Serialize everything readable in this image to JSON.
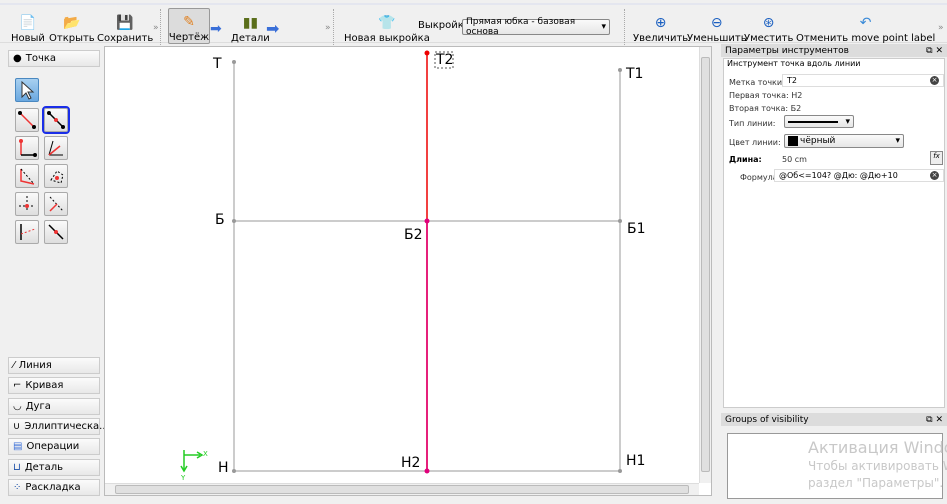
{
  "toolbar": {
    "new": "Новый",
    "open": "Открыть",
    "save": "Сохранить",
    "draw": "Чертёж",
    "details": "Детали",
    "new_pattern": "Новая выкройка",
    "pattern_label": "Выкройка:",
    "pattern_value": "Прямая юбка - базовая основа",
    "zoom_in": "Увеличить",
    "zoom_out": "Уменьшить",
    "fit": "Уместить",
    "undo": "Отменить move point label"
  },
  "left": {
    "group_point": "Точка",
    "groups": [
      "Линия",
      "Кривая",
      "Дуга",
      "Эллиптическа...",
      "Операции",
      "Деталь",
      "Раскладка"
    ]
  },
  "canvas": {
    "points": {
      "T": "Т",
      "T2": "Т2",
      "T1": "Т1",
      "B": "Б",
      "B2": "Б2",
      "B1": "Б1",
      "H": "Н",
      "H2": "Н2",
      "H1": "Н1"
    },
    "axis_x": "X",
    "axis_y": "Y",
    "accent_line_color": "#e0007a"
  },
  "tool_options": {
    "title": "Параметры инструментов",
    "subtitle": "Инструмент точка вдоль линии",
    "point_label_label": "Метка точки:",
    "point_label_value": "Т2",
    "first_point_label": "Первая точка:",
    "first_point_value": "Н2",
    "second_point_label": "Вторая точка:",
    "second_point_value": "Б2",
    "line_type_label": "Тип линии:",
    "line_color_label": "Цвет линии:",
    "line_color_value": "чёрный",
    "length_label": "Длина:",
    "length_value": "50 cm",
    "formula_label": "Формула",
    "formula_value": "@Об<=104? @Дю: @Дю+10"
  },
  "groups_panel": {
    "title": "Groups of visibility"
  },
  "watermark": {
    "line1": "Активация Windows",
    "line2": "Чтобы активировать Windows, перейдите в",
    "line3": "раздел \"Параметры\"."
  }
}
